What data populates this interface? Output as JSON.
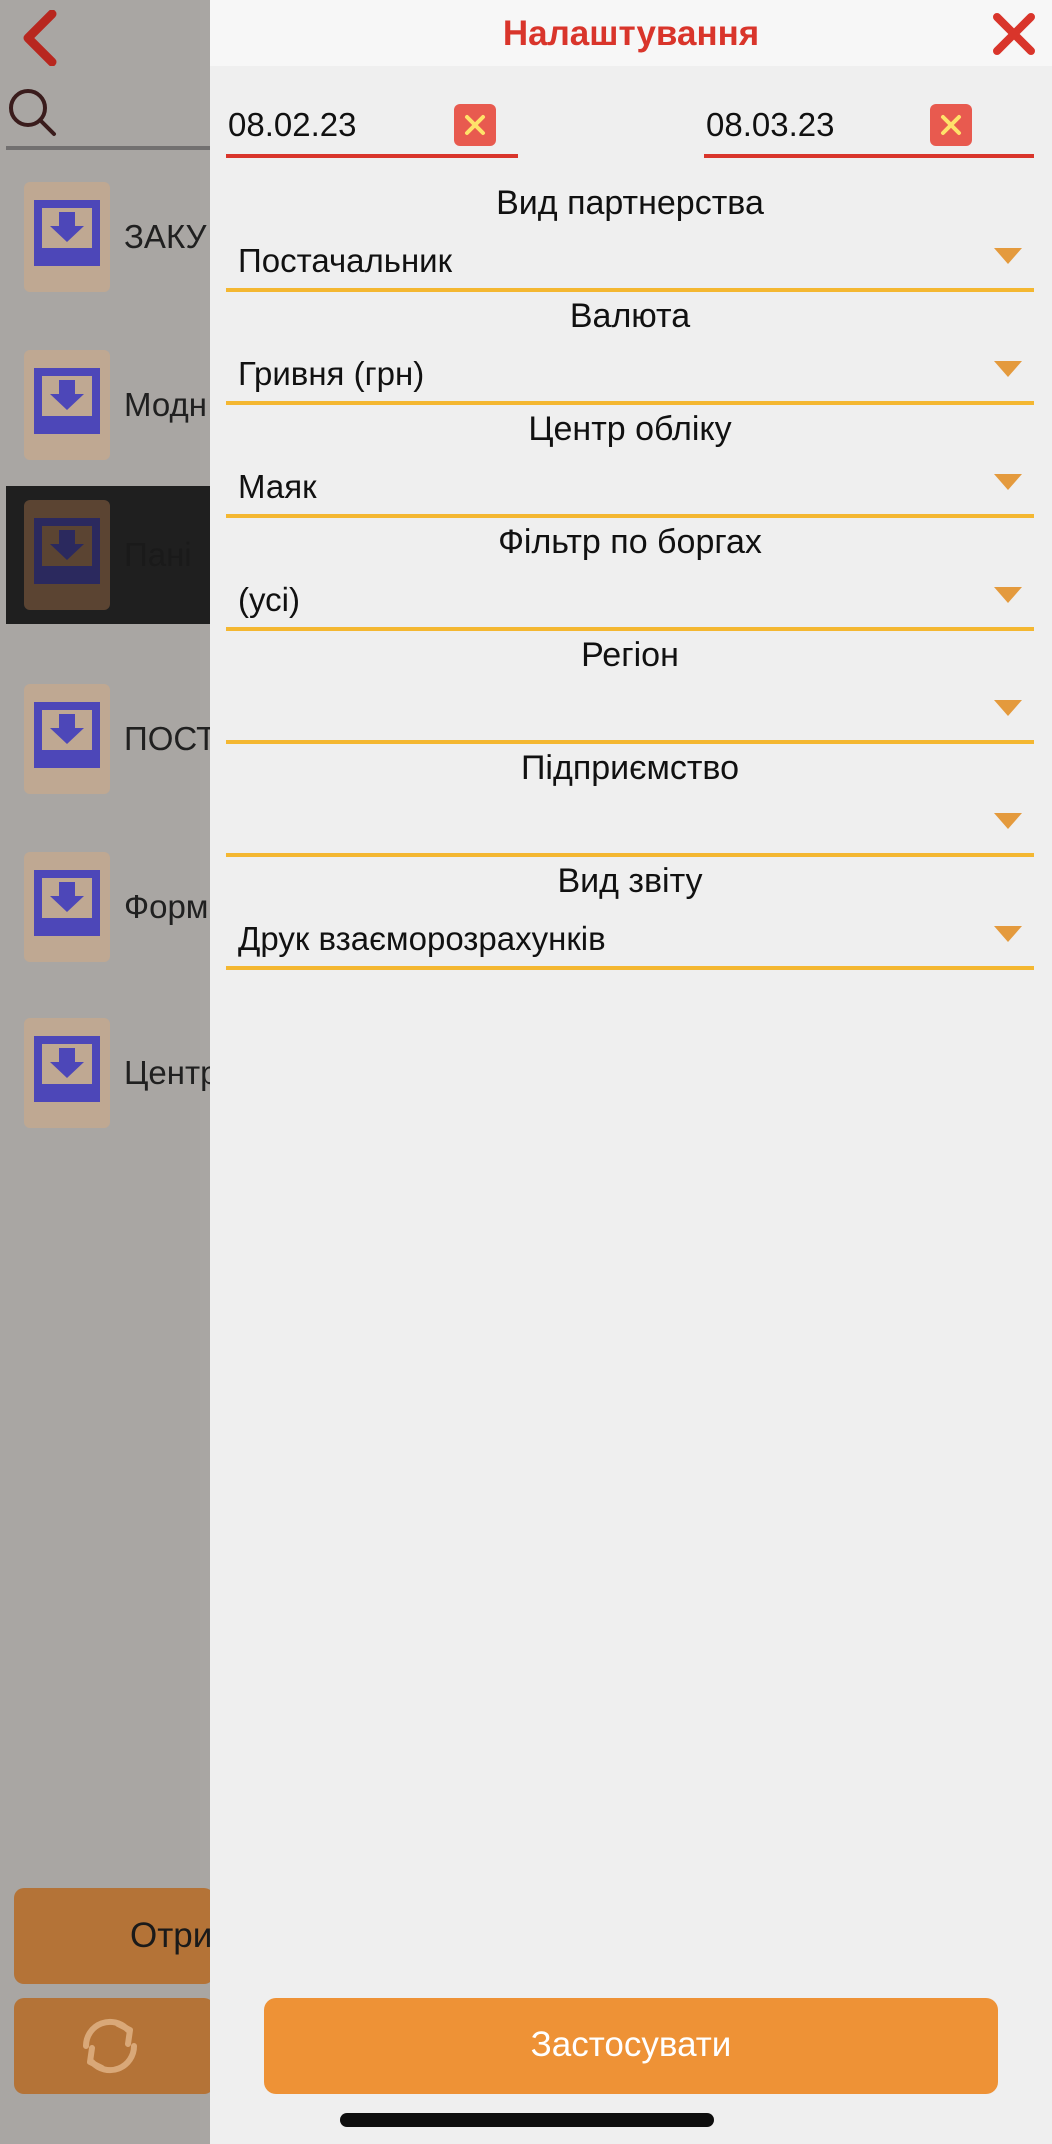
{
  "background": {
    "items": [
      {
        "label": "ЗАКУ"
      },
      {
        "label": "Модн"
      },
      {
        "label": "Пані"
      },
      {
        "label": "ПОСТ"
      },
      {
        "label": "Форм"
      },
      {
        "label": "Центр"
      }
    ],
    "get_button_label": "Отри"
  },
  "panel": {
    "title": "Налаштування",
    "date_from": "08.02.23",
    "date_to": "08.03.23",
    "fields": [
      {
        "label": "Вид партнерства",
        "value": "Постачальник"
      },
      {
        "label": "Валюта",
        "value": "Гривня (грн)"
      },
      {
        "label": "Центр обліку",
        "value": "Маяк"
      },
      {
        "label": "Фільтр по боргах",
        "value": "(усі)"
      },
      {
        "label": "Регіон",
        "value": ""
      },
      {
        "label": "Підприємство",
        "value": ""
      },
      {
        "label": "Вид звіту",
        "value": "Друк взаєморозрахунків"
      }
    ],
    "apply_label": "Застосувати"
  },
  "colors": {
    "accent_red": "#d9352b",
    "underline_yellow": "#f4b731",
    "apply_orange": "#ee9236",
    "dropdown_arrow": "#e49a3d"
  }
}
